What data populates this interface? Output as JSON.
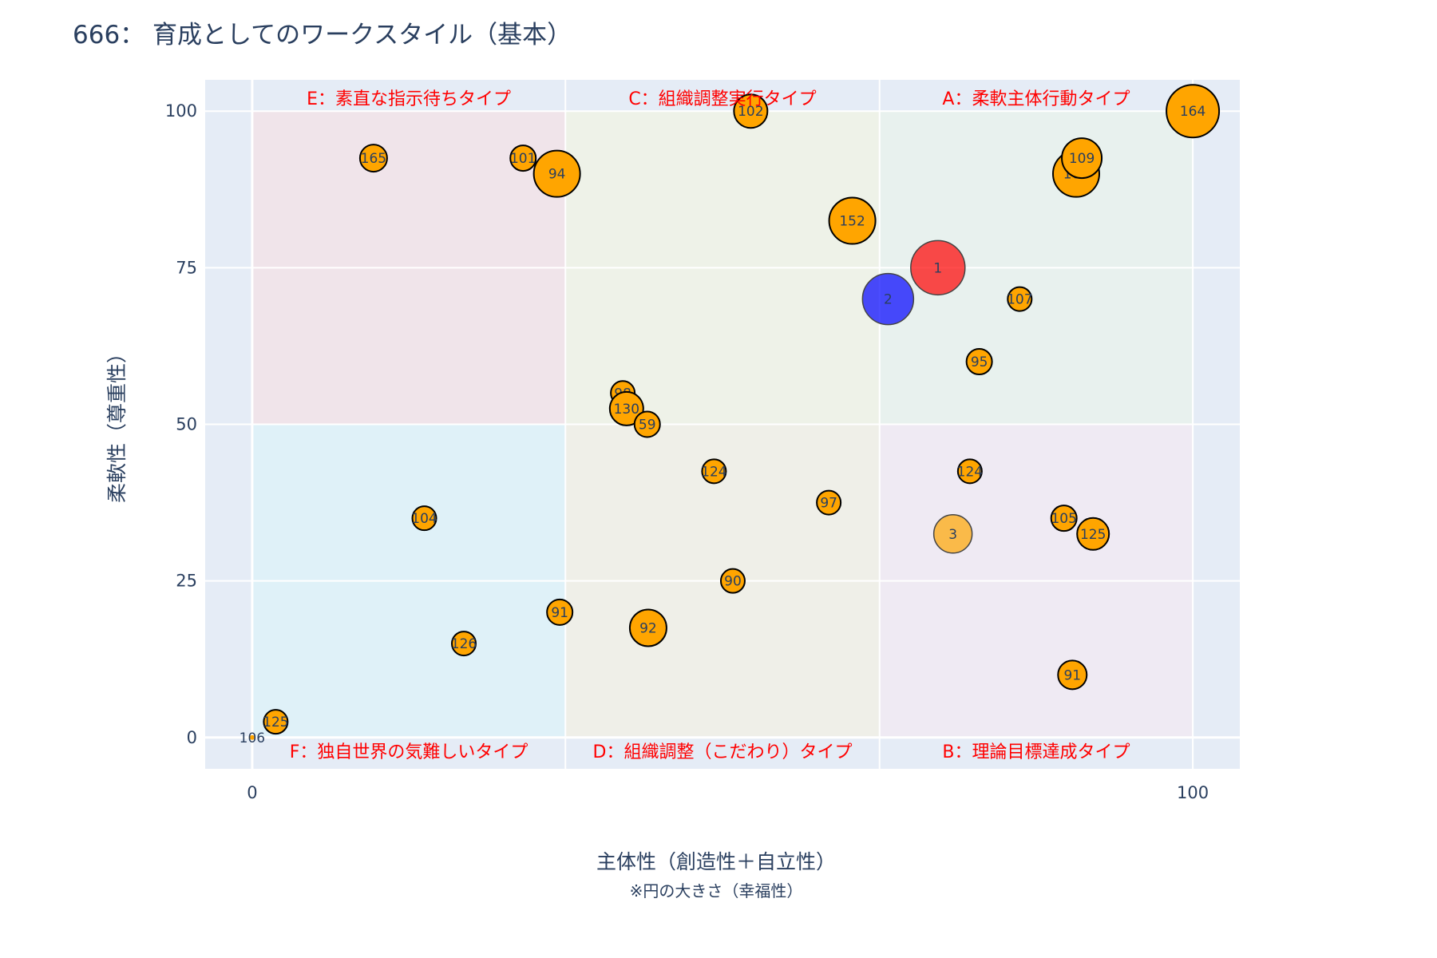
{
  "chart_data": {
    "type": "scatter",
    "title": "666： 育成としてのワークスタイル（基本）",
    "xlabel": "主体性（創造性＋自立性）",
    "xsublabel": "※円の大きさ（幸福性）",
    "ylabel": "柔軟性（尊重性）",
    "xlim": [
      -5,
      105
    ],
    "ylim": [
      -5,
      105
    ],
    "x_ticks": [
      0,
      100
    ],
    "y_ticks": [
      0,
      25,
      50,
      75,
      100
    ],
    "grid": true,
    "plot_background": "#e5ecf6",
    "quadrants": [
      {
        "label": "E：素直な指示待ちタイプ",
        "x": [
          0,
          33.3
        ],
        "y": [
          50,
          100
        ],
        "color": "#f0e4ea",
        "label_pos": "top"
      },
      {
        "label": "C：組織調整実行タイプ",
        "x": [
          33.3,
          66.7
        ],
        "y": [
          50,
          100
        ],
        "color": "#eef2e8",
        "label_pos": "top"
      },
      {
        "label": "A：柔軟主体行動タイプ",
        "x": [
          66.7,
          100
        ],
        "y": [
          50,
          100
        ],
        "color": "#e8f1ee",
        "label_pos": "top"
      },
      {
        "label": "F：独自世界の気難しいタイプ",
        "x": [
          0,
          33.3
        ],
        "y": [
          0,
          50
        ],
        "color": "#dff1f8",
        "label_pos": "bottom"
      },
      {
        "label": "D：組織調整（こだわり）タイプ",
        "x": [
          33.3,
          66.7
        ],
        "y": [
          0,
          50
        ],
        "color": "#efefe8",
        "label_pos": "bottom"
      },
      {
        "label": "B：理論目標達成タイプ",
        "x": [
          66.7,
          100
        ],
        "y": [
          0,
          50
        ],
        "color": "#efeaf3",
        "label_pos": "bottom"
      }
    ],
    "series": [
      {
        "name": "",
        "color": "#ff0000",
        "opacity": 0.7,
        "points": [
          {
            "x": 72.9,
            "y": 75,
            "size": 68,
            "label": "1"
          }
        ]
      },
      {
        "name": "",
        "color": "#0000ff",
        "opacity": 0.7,
        "points": [
          {
            "x": 67.6,
            "y": 70,
            "size": 64,
            "label": "2"
          }
        ]
      },
      {
        "name": "",
        "color": "#ffa500",
        "opacity": 0.7,
        "points": [
          {
            "x": 74.5,
            "y": 32.5,
            "size": 48,
            "label": "3"
          }
        ]
      },
      {
        "name": "",
        "color": "#ffa500",
        "opacity": 1,
        "stroke": "#000000",
        "points": [
          {
            "x": 100,
            "y": 100,
            "size": 66,
            "label": "164"
          },
          {
            "x": 53,
            "y": 100,
            "size": 42,
            "label": "102"
          },
          {
            "x": 87.6,
            "y": 90,
            "size": 58,
            "label": "108"
          },
          {
            "x": 88.2,
            "y": 92.5,
            "size": 50,
            "label": "109"
          },
          {
            "x": 12.9,
            "y": 92.5,
            "size": 34,
            "label": "165"
          },
          {
            "x": 28.8,
            "y": 92.5,
            "size": 32,
            "label": "101"
          },
          {
            "x": 32.4,
            "y": 90,
            "size": 58,
            "label": "94"
          },
          {
            "x": 63.8,
            "y": 82.5,
            "size": 58,
            "label": "152"
          },
          {
            "x": 81.6,
            "y": 70,
            "size": 30,
            "label": "107"
          },
          {
            "x": 77.3,
            "y": 60,
            "size": 32,
            "label": "95"
          },
          {
            "x": 39.4,
            "y": 55,
            "size": 30,
            "label": "98"
          },
          {
            "x": 39.8,
            "y": 52.5,
            "size": 42,
            "label": "130"
          },
          {
            "x": 42,
            "y": 50,
            "size": 32,
            "label": "59"
          },
          {
            "x": 49.1,
            "y": 42.5,
            "size": 30,
            "label": "124"
          },
          {
            "x": 76.3,
            "y": 42.5,
            "size": 30,
            "label": "124"
          },
          {
            "x": 61.3,
            "y": 37.5,
            "size": 30,
            "label": "97"
          },
          {
            "x": 18.3,
            "y": 35,
            "size": 30,
            "label": "104"
          },
          {
            "x": 86.3,
            "y": 35,
            "size": 32,
            "label": "105"
          },
          {
            "x": 89.4,
            "y": 32.5,
            "size": 40,
            "label": "125"
          },
          {
            "x": 51.1,
            "y": 25,
            "size": 30,
            "label": "90"
          },
          {
            "x": 32.7,
            "y": 20,
            "size": 32,
            "label": "91"
          },
          {
            "x": 42.1,
            "y": 17.5,
            "size": 46,
            "label": "92"
          },
          {
            "x": 22.5,
            "y": 15,
            "size": 30,
            "label": "126"
          },
          {
            "x": 87.2,
            "y": 10,
            "size": 36,
            "label": "91"
          },
          {
            "x": 2.5,
            "y": 2.5,
            "size": 30,
            "label": "125"
          }
        ]
      },
      {
        "name": "",
        "color": "#ffa500",
        "opacity": 1,
        "stroke": "none",
        "points": [
          {
            "x": 0,
            "y": 0,
            "size": 6,
            "label": "106"
          }
        ]
      }
    ]
  }
}
